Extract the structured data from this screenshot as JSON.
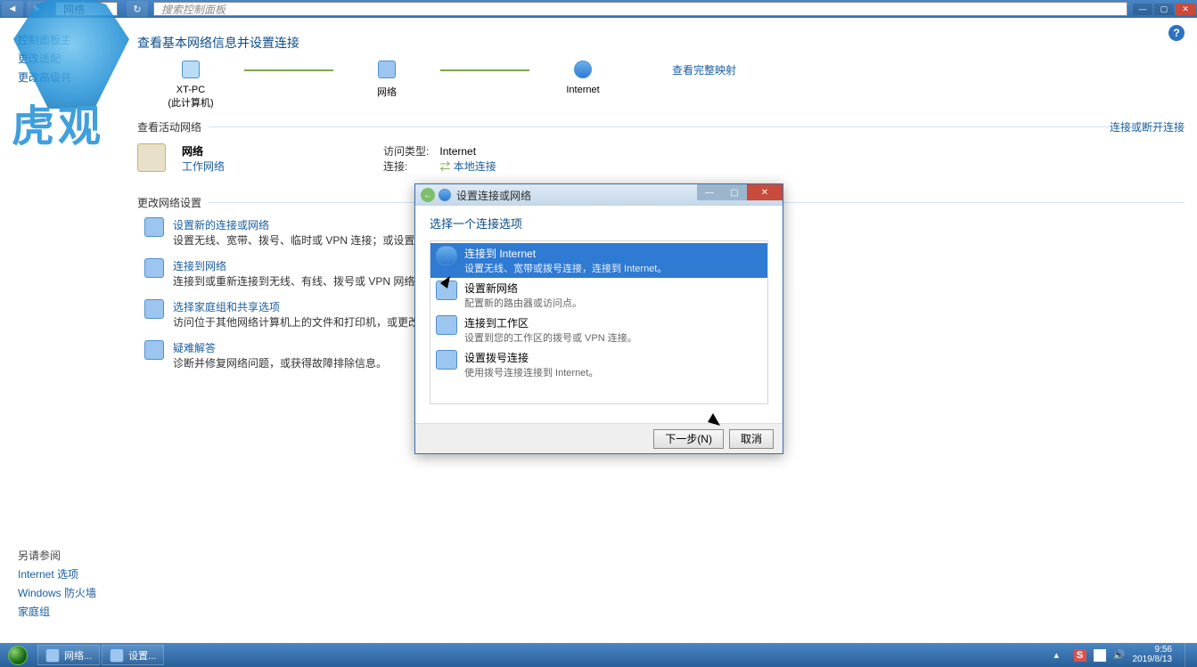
{
  "addr": {
    "path": "网络",
    "search_placeholder": "搜索控制面板"
  },
  "help_icon": "?",
  "sidebar": {
    "items": [
      "控制面板主",
      "更改适配",
      "更改高级共"
    ],
    "see_also_hdr": "另请参阅",
    "see_also": [
      "Internet 选项",
      "Windows 防火墙",
      "家庭组"
    ]
  },
  "content": {
    "title": "查看基本网络信息并设置连接",
    "topo": {
      "n1": {
        "label": "XT-PC",
        "sub": "(此计算机)"
      },
      "n2": {
        "label": "网络"
      },
      "n3": {
        "label": "Internet"
      },
      "right_link": "查看完整映射"
    },
    "section_active": "查看活动网络",
    "section_active_link": "连接或断开连接",
    "active_net": {
      "name": "网络",
      "type_link": "工作网络"
    },
    "kv": {
      "k1": "访问类型:",
      "v1": "Internet",
      "k2": "连接:",
      "v2": "本地连接"
    },
    "section_change": "更改网络设置",
    "tasks": [
      {
        "t": "设置新的连接或网络",
        "d": "设置无线、宽带、拨号、临时或 VPN 连接；或设置路由器或访问点。"
      },
      {
        "t": "连接到网络",
        "d": "连接到或重新连接到无线、有线、拨号或 VPN 网络连接。"
      },
      {
        "t": "选择家庭组和共享选项",
        "d": "访问位于其他网络计算机上的文件和打印机，或更改共享设置。"
      },
      {
        "t": "疑难解答",
        "d": "诊断并修复网络问题，或获得故障排除信息。"
      }
    ]
  },
  "dialog": {
    "title": "设置连接或网络",
    "heading": "选择一个连接选项",
    "options": [
      {
        "t": "连接到 Internet",
        "d": "设置无线、宽带或拨号连接，连接到 Internet。"
      },
      {
        "t": "设置新网络",
        "d": "配置新的路由器或访问点。"
      },
      {
        "t": "连接到工作区",
        "d": "设置到您的工作区的拨号或 VPN 连接。"
      },
      {
        "t": "设置拨号连接",
        "d": "使用拨号连接连接到 Internet。"
      }
    ],
    "btn_next": "下一步(N)",
    "btn_cancel": "取消"
  },
  "taskbar": {
    "items": [
      "网络...",
      "设置..."
    ],
    "tray_lang": "S",
    "time": "9:56",
    "date": "2019/8/13"
  },
  "watermark": "虎观"
}
